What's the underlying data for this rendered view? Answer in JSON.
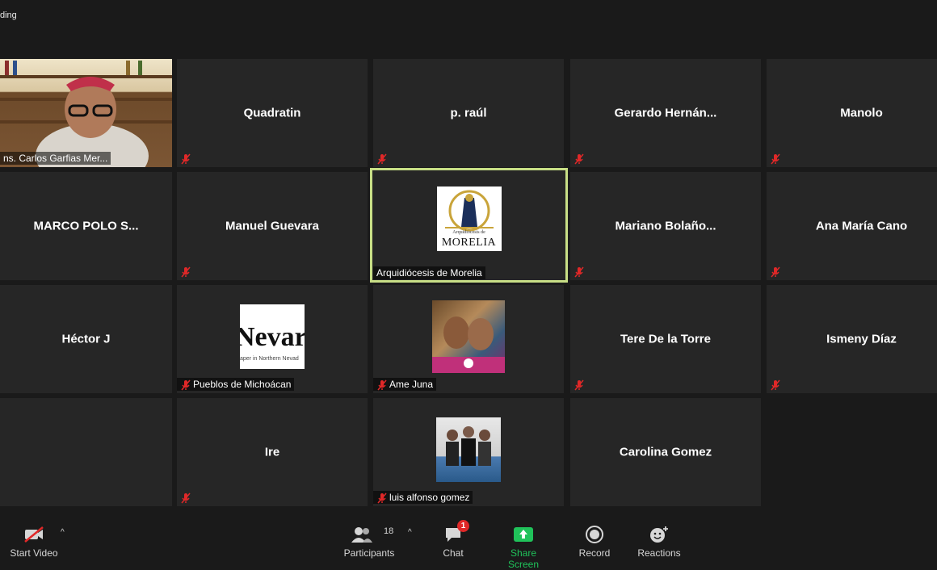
{
  "recording_label": "ding",
  "self_view": {
    "name": "ns. Carlos Garfias Mer..."
  },
  "tiles": [
    {
      "name": "Quadratin"
    },
    {
      "name": "p. raúl"
    },
    {
      "name": "Gerardo  Hernán..."
    },
    {
      "name": "Manolo"
    },
    {
      "name": "MARCO  POLO  S..."
    },
    {
      "name": "Manuel Guevara"
    },
    {
      "name": "Arquidiócesis de Morelia",
      "logo_text_top": "Arquidiócesis de",
      "logo_text_main": "MORELIA"
    },
    {
      "name": "Mariano  Bolaño..."
    },
    {
      "name": "Ana María Cano"
    },
    {
      "name": "Héctor J"
    },
    {
      "name": "Pueblos de Michoácan",
      "img_text_main": "Nevar",
      "img_text_sub": "aper in Northern Nevad"
    },
    {
      "name": "Ame Juna"
    },
    {
      "name": "Tere De la Torre"
    },
    {
      "name": "Ismeny Díaz"
    },
    {
      "name": "Ire"
    },
    {
      "name": "luis alfonso gomez"
    },
    {
      "name": "Carolina Gomez"
    }
  ],
  "toolbar": {
    "start_video": "Start Video",
    "participants": "Participants",
    "participants_count": "18",
    "chat": "Chat",
    "chat_badge": "1",
    "share_screen": "Share Screen",
    "record": "Record",
    "reactions": "Reactions"
  },
  "colors": {
    "active_border": "#c8df86",
    "share_green": "#20c25a",
    "mute_red": "#e02828"
  }
}
